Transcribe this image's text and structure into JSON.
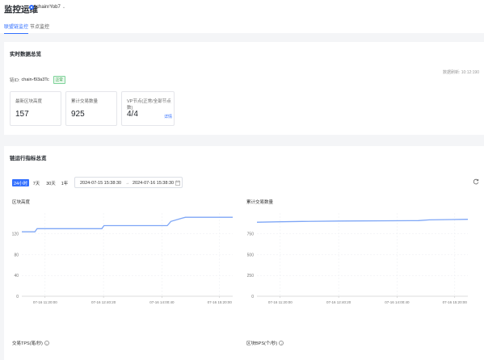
{
  "header": {
    "title": "监控运维",
    "chain_selector": "chainrYob7",
    "tabs": [
      {
        "label": "联盟链监控",
        "active": true
      },
      {
        "label": "节点监控",
        "active": false
      }
    ]
  },
  "realtime": {
    "title": "实时数据总览",
    "sync_time": "数据刷新: 10:12:190",
    "chain_id_label": "链ID:",
    "chain_id_value": "chain-f93a3Tc",
    "status_badge": "正常",
    "stats": [
      {
        "label": "最新区块高度",
        "value": "157"
      },
      {
        "label": "累计交易数量",
        "value": "925"
      },
      {
        "label": "VP节点(正常/全部节点数)",
        "value": "4/4",
        "link": "详情"
      }
    ]
  },
  "metrics": {
    "title": "链运行指标总览",
    "range_buttons": [
      {
        "label": "24小时",
        "active": true
      },
      {
        "label": "7天",
        "active": false
      },
      {
        "label": "30天",
        "active": false
      },
      {
        "label": "1年",
        "active": false
      }
    ],
    "date_start": "2024-07-15 15:38:30",
    "date_sep": "→",
    "date_end": "2024-07-16 15:38:30",
    "calendar_icon": "calendar-icon",
    "refresh_icon": "refresh-icon",
    "bottom_titles": [
      "交易TPS(笔/秒)",
      "区块BPS(个/秒)"
    ]
  },
  "chart_data": [
    {
      "type": "line",
      "title": "区块高度",
      "x_ticks": [
        "07-16 11:20:00",
        "07-16 12:40:20",
        "07-16 14:00:40",
        "07-16 15:20:00"
      ],
      "y_ticks": [
        0,
        40,
        80,
        120
      ],
      "ylim": [
        0,
        160
      ],
      "grid": true,
      "color": "#7ea6f6",
      "points": [
        [
          "07-16 10:48",
          124
        ],
        [
          "07-16 11:06",
          124
        ],
        [
          "07-16 11:09",
          130
        ],
        [
          "07-16 12:38",
          130
        ],
        [
          "07-16 12:41",
          136
        ],
        [
          "07-16 14:08",
          136
        ],
        [
          "07-16 14:13",
          144
        ],
        [
          "07-16 14:28",
          150
        ],
        [
          "07-16 14:33",
          152
        ],
        [
          "07-16 15:38",
          152
        ]
      ]
    },
    {
      "type": "line",
      "title": "累计交易数量",
      "x_ticks": [
        "07-16 11:20:00",
        "07-16 12:40:20",
        "07-16 14:00:40",
        "07-16 15:20:00"
      ],
      "y_ticks": [
        0,
        250,
        500,
        750
      ],
      "ylim": [
        0,
        1000
      ],
      "grid": true,
      "color": "#7ea6f6",
      "points": [
        [
          "07-16 10:48",
          890
        ],
        [
          "07-16 11:15",
          895
        ],
        [
          "07-16 11:50",
          900
        ],
        [
          "07-16 12:45",
          905
        ],
        [
          "07-16 14:30",
          910
        ],
        [
          "07-16 14:45",
          918
        ],
        [
          "07-16 15:15",
          922
        ],
        [
          "07-16 15:38",
          925
        ]
      ]
    }
  ]
}
